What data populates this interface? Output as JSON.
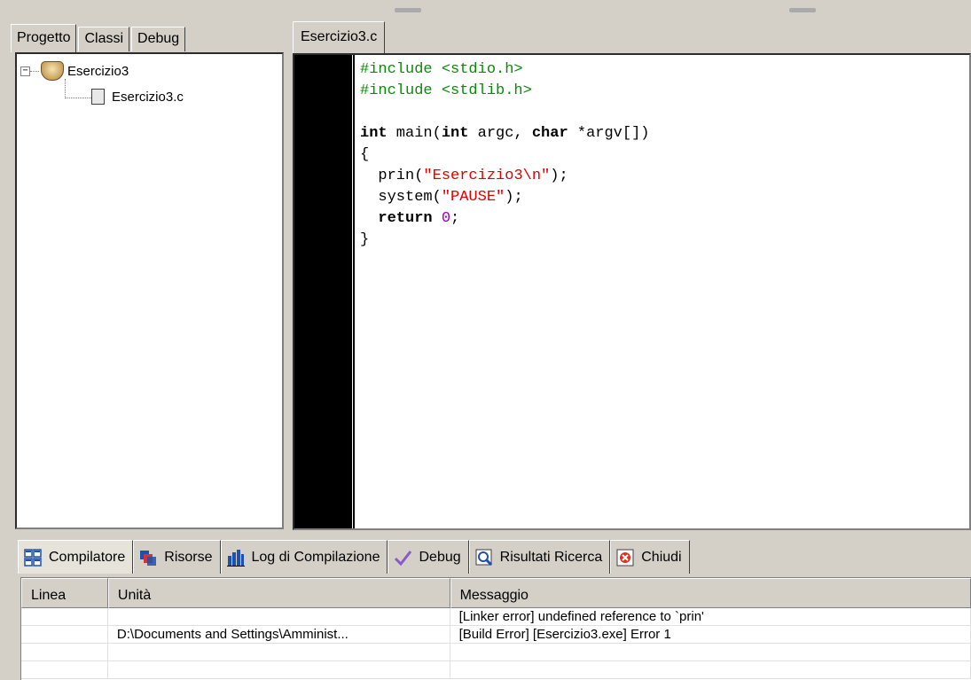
{
  "left_tabs": [
    "Progetto",
    "Classi",
    "Debug"
  ],
  "project": {
    "name": "Esercizio3",
    "file": "Esercizio3.c",
    "expander_symbol": "−"
  },
  "editor": {
    "tab_label": "Esercizio3.c",
    "code_lines": [
      [
        {
          "t": "#include <stdio.h>",
          "c": "pp"
        }
      ],
      [
        {
          "t": "#include <stdlib.h>",
          "c": "pp"
        }
      ],
      [],
      [
        {
          "t": "int",
          "c": "kw"
        },
        {
          "t": " main("
        },
        {
          "t": "int",
          "c": "kw"
        },
        {
          "t": " argc, "
        },
        {
          "t": "char",
          "c": "kw"
        },
        {
          "t": " *argv[])"
        }
      ],
      [
        {
          "t": "{"
        }
      ],
      [
        {
          "t": "  prin("
        },
        {
          "t": "\"Esercizio3\\n\"",
          "c": "str"
        },
        {
          "t": ");"
        }
      ],
      [
        {
          "t": "  system("
        },
        {
          "t": "\"PAUSE\"",
          "c": "str"
        },
        {
          "t": ");"
        }
      ],
      [
        {
          "t": "  "
        },
        {
          "t": "return",
          "c": "kw"
        },
        {
          "t": " "
        },
        {
          "t": "0",
          "c": "num"
        },
        {
          "t": ";"
        }
      ],
      [
        {
          "t": "}"
        }
      ]
    ]
  },
  "bottom_tabs": [
    {
      "label": "Compilatore",
      "icon": "compiler-icon"
    },
    {
      "label": "Risorse",
      "icon": "resources-icon"
    },
    {
      "label": "Log di Compilazione",
      "icon": "compile-log-icon"
    },
    {
      "label": "Debug",
      "icon": "debug-check-icon"
    },
    {
      "label": "Risultati Ricerca",
      "icon": "search-results-icon"
    },
    {
      "label": "Chiudi",
      "icon": "close-panel-icon"
    }
  ],
  "grid": {
    "headers": [
      "Linea",
      "Unità",
      "Messaggio"
    ],
    "rows": [
      {
        "linea": "",
        "unita": "",
        "messaggio": "[Linker error] undefined reference to `prin'"
      },
      {
        "linea": "",
        "unita": "D:\\Documents and Settings\\Amminist...",
        "messaggio": "[Build Error]  [Esercizio3.exe] Error 1"
      },
      {
        "linea": "",
        "unita": "",
        "messaggio": ""
      },
      {
        "linea": "",
        "unita": "",
        "messaggio": ""
      }
    ]
  },
  "colors": {
    "preprocessor": "#0a8a0a",
    "string": "#e00000",
    "number": "#9b00c8",
    "gutter": "#000000",
    "chrome": "#d4d0c8"
  }
}
